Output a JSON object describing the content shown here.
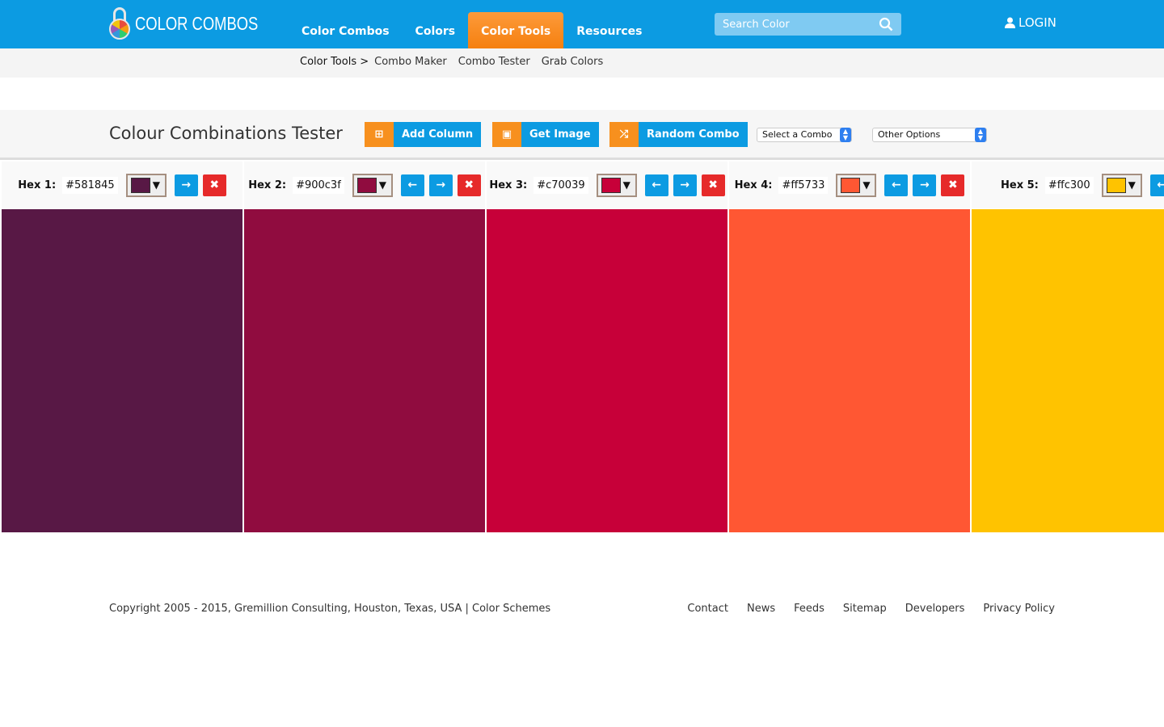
{
  "header": {
    "logo": "COLOR COMBOS",
    "nav": [
      {
        "label": "Color Combos",
        "active": false
      },
      {
        "label": "Colors",
        "active": false
      },
      {
        "label": "Color Tools",
        "active": true
      },
      {
        "label": "Resources",
        "active": false
      }
    ],
    "search_placeholder": "Search Color",
    "login": "LOGIN",
    "search_icon": "magnifier",
    "login_icon": "user"
  },
  "subnav": {
    "current": "Color Tools >",
    "items": [
      "Combo Maker",
      "Combo Tester",
      "Grab Colors"
    ]
  },
  "toolbar": {
    "title": "Colour Combinations Tester",
    "add_column": "Add Column",
    "get_image": "Get Image",
    "random_combo": "Random Combo",
    "select_combo": "Select a Combo",
    "other_options": "Other Options"
  },
  "columns": [
    {
      "label": "Hex 1:",
      "hex": "#581845",
      "color": "#581845",
      "left": false,
      "right": true
    },
    {
      "label": "Hex 2:",
      "hex": "#900c3f",
      "color": "#900c3f",
      "left": true,
      "right": true
    },
    {
      "label": "Hex 3:",
      "hex": "#c70039",
      "color": "#c70039",
      "left": true,
      "right": true
    },
    {
      "label": "Hex 4:",
      "hex": "#ff5733",
      "color": "#ff5733",
      "left": true,
      "right": true
    },
    {
      "label": "Hex 5:",
      "hex": "#ffc300",
      "color": "#ffc300",
      "left": true,
      "right": false
    }
  ],
  "footer": {
    "copyright": "Copyright 2005 - 2015, Gremillion Consulting, Houston, Texas, USA | Color Schemes",
    "links": [
      "Contact",
      "News",
      "Feeds",
      "Sitemap",
      "Developers",
      "Privacy Policy"
    ]
  }
}
